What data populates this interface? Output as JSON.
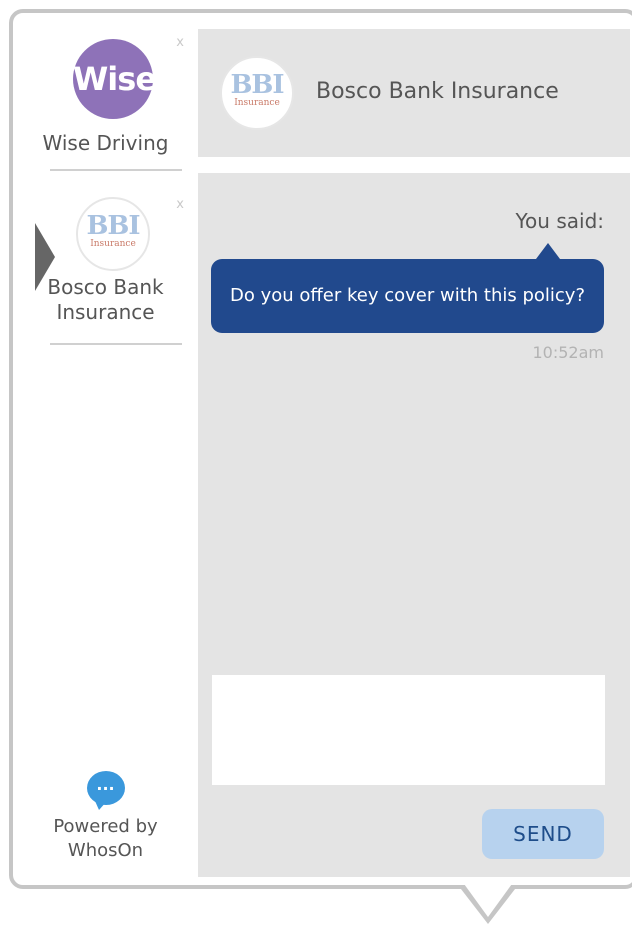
{
  "contacts": [
    {
      "name": "Wise Driving",
      "logo_text": "Wise",
      "close": "x"
    },
    {
      "name": "Bosco Bank Insurance",
      "logo_big": "BBI",
      "logo_small": "Insurance",
      "close": "x"
    }
  ],
  "powered": {
    "text": "Powered by WhosOn",
    "icon_text": "..."
  },
  "header": {
    "title": "Bosco Bank Insurance",
    "logo_big": "BBI",
    "logo_small": "Insurance"
  },
  "chat": {
    "you_said_label": "You said:",
    "message": "Do you offer key cover with this policy?",
    "time": "10:52am"
  },
  "composer": {
    "placeholder": ""
  },
  "send_label": "SEND",
  "colors": {
    "wise_purple": "#8e72b8",
    "bubble_navy": "#21498d",
    "panel_gray": "#e4e4e4",
    "send_button": "#b7d2ee",
    "icon_blue": "#3a98dc"
  }
}
